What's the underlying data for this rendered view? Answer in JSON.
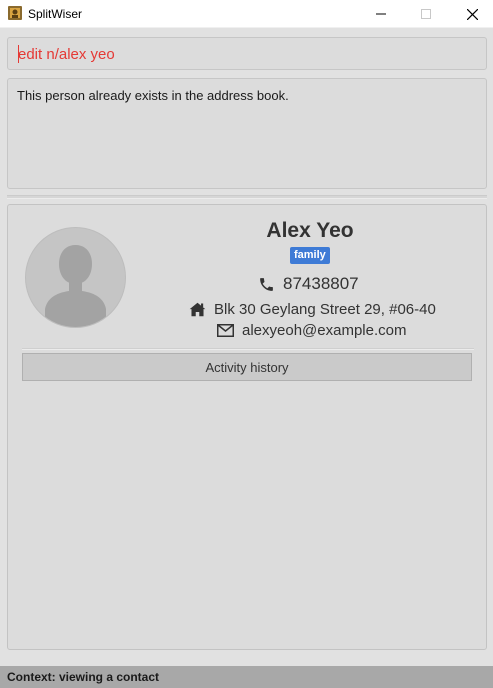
{
  "window": {
    "title": "SplitWiser",
    "controls": {
      "minimize": "minimize-icon",
      "maximize": "maximize-icon",
      "close": "close-icon"
    }
  },
  "command": {
    "value": "edit n/alex yeo",
    "color": "#e53935"
  },
  "result": {
    "message": "This person already exists in the address book."
  },
  "contact": {
    "name": "Alex Yeo",
    "tags": [
      "family"
    ],
    "phone": "87438807",
    "address": "Blk 30 Geylang Street 29, #06-40",
    "email": "alexyeoh@example.com",
    "avatar_icon": "default-avatar-icon",
    "phone_icon": "phone-icon",
    "address_icon": "home-icon",
    "email_icon": "envelope-icon",
    "tag_color": "#3e7bd6"
  },
  "activity": {
    "button_label": "Activity history"
  },
  "status": {
    "text": "Context: viewing a contact"
  }
}
